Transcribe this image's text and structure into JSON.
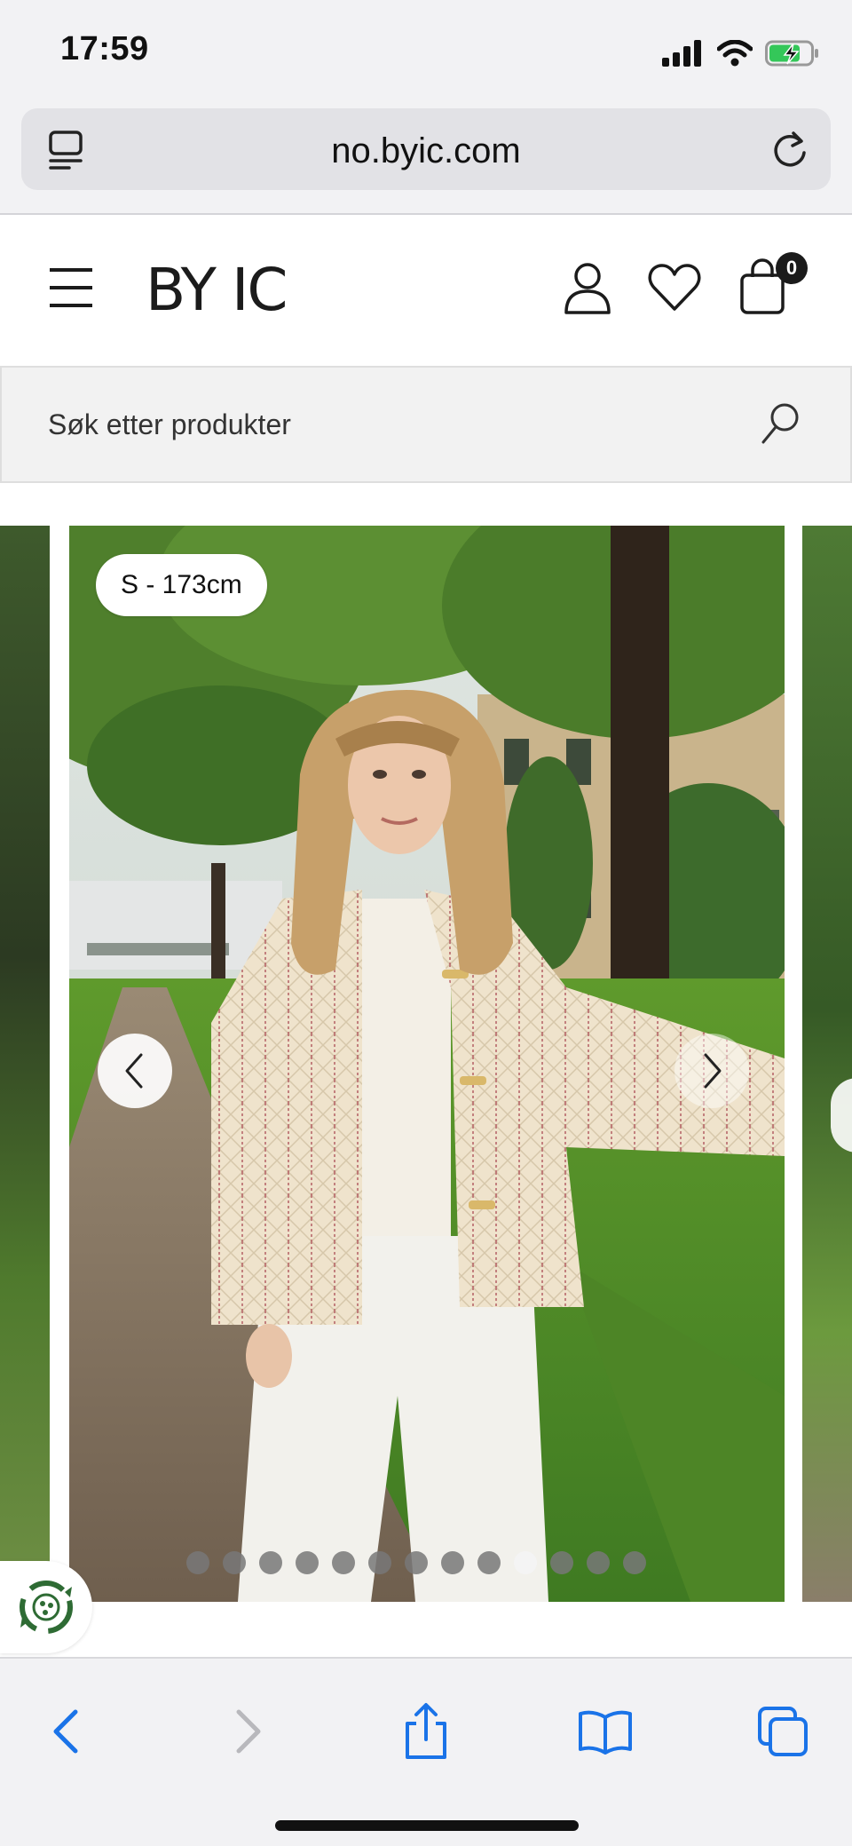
{
  "status_bar": {
    "time": "17:59",
    "icons": [
      "cellular-signal-icon",
      "wifi-icon",
      "battery-charging-icon"
    ]
  },
  "browser": {
    "url": "no.byic.com",
    "icons": [
      "tab-overview-icon",
      "reload-icon"
    ]
  },
  "header": {
    "logo": "BY IC",
    "cart_count": "0",
    "icons": [
      "menu-icon",
      "account-icon",
      "wishlist-heart-icon",
      "shopping-bag-icon"
    ]
  },
  "search": {
    "placeholder": "Søk etter produkter",
    "icon": "search-icon"
  },
  "carousel": {
    "size_label": "S - 173cm",
    "total_images": 13,
    "active_index": 10,
    "prev_icon": "chevron-left-icon",
    "next_icon": "chevron-right-icon"
  },
  "eco_badge": {
    "icon": "recycle-leaf-icon"
  },
  "toolbar": {
    "items": [
      "back-icon",
      "forward-icon",
      "share-icon",
      "bookmarks-icon",
      "tabs-icon"
    ],
    "accent": "#1a73e8"
  }
}
